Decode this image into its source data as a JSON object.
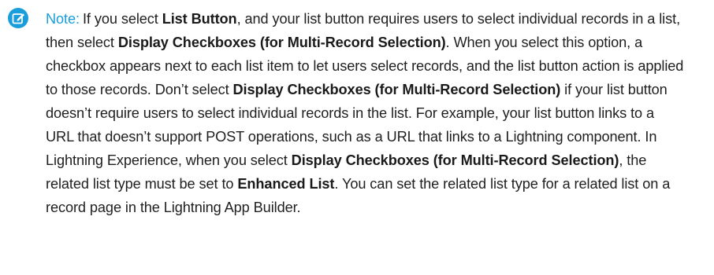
{
  "note": {
    "icon": "edit-note-icon",
    "icon_color": "#1a9edb",
    "label": "Note:",
    "segments": [
      "If you select ",
      "List Button",
      ", and your list button requires users to select individual records in a list, then select ",
      "Display Checkboxes (for Multi-Record Selection)",
      ". When you select this option, a checkbox appears next to each list item to let users select records, and the list button action is applied to those records. Don’t select ",
      "Display Checkboxes (for Multi-Record Selection)",
      " if your list button doesn’t require users to select individual records in the list. For example, your list button links to a URL that doesn’t support POST operations, such as a URL that links to a Lightning component. In Lightning Experience, when you select ",
      "Display Checkboxes (for Multi-Record Selection)",
      ", the related list type must be set to ",
      "Enhanced List",
      ". You can set the related list type for a related list on a record page in the Lightning App Builder."
    ]
  }
}
